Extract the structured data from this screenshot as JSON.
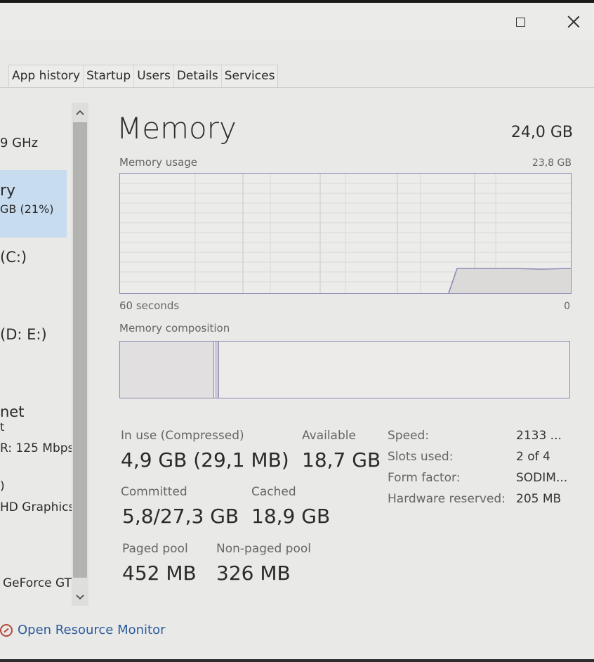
{
  "window": {
    "maximize_icon": "maximize-icon",
    "close_icon": "close-icon"
  },
  "tabs": [
    "App history",
    "Startup",
    "Users",
    "Details",
    "Services"
  ],
  "sidebar": {
    "items": [
      {
        "label": "9 GHz",
        "sub": ""
      },
      {
        "label": "ry",
        "sub": "GB (21%)"
      },
      {
        "label": "(C:)",
        "sub": ""
      },
      {
        "label": "(D: E:)",
        "sub": ""
      },
      {
        "label": "net",
        "sub": "t"
      },
      {
        "label": "R: 125 Mbps",
        "sub": ""
      },
      {
        "label": ")",
        "sub": ""
      },
      {
        "label": "HD Graphics",
        "sub": ""
      },
      {
        "label": "GeForce GTX",
        "sub": ""
      }
    ],
    "scroll_up_icon": "chevron-up-icon",
    "scroll_down_icon": "chevron-down-icon"
  },
  "memory": {
    "title": "Memory",
    "total": "24,0 GB",
    "usage_label": "Memory usage",
    "usage_max": "23,8 GB",
    "axis_left": "60 seconds",
    "axis_right": "0",
    "composition_label": "Memory composition",
    "graph_color": "#8f88b4"
  },
  "stats": {
    "in_use_label": "In use (Compressed)",
    "in_use_value": "4,9 GB (29,1 MB)",
    "available_label": "Available",
    "available_value": "18,7 GB",
    "committed_label": "Committed",
    "committed_value": "5,8/27,3 GB",
    "cached_label": "Cached",
    "cached_value": "18,9 GB",
    "paged_label": "Paged pool",
    "paged_value": "452 MB",
    "nonpaged_label": "Non-paged pool",
    "nonpaged_value": "326 MB"
  },
  "specs": {
    "speed_label": "Speed:",
    "speed_value": "2133 ...",
    "slots_label": "Slots used:",
    "slots_value": "2 of 4",
    "form_label": "Form factor:",
    "form_value": "SODIM...",
    "hw_label": "Hardware reserved:",
    "hw_value": "205 MB"
  },
  "footer": {
    "link": "Open Resource Monitor",
    "icon": "resource-monitor-icon"
  }
}
